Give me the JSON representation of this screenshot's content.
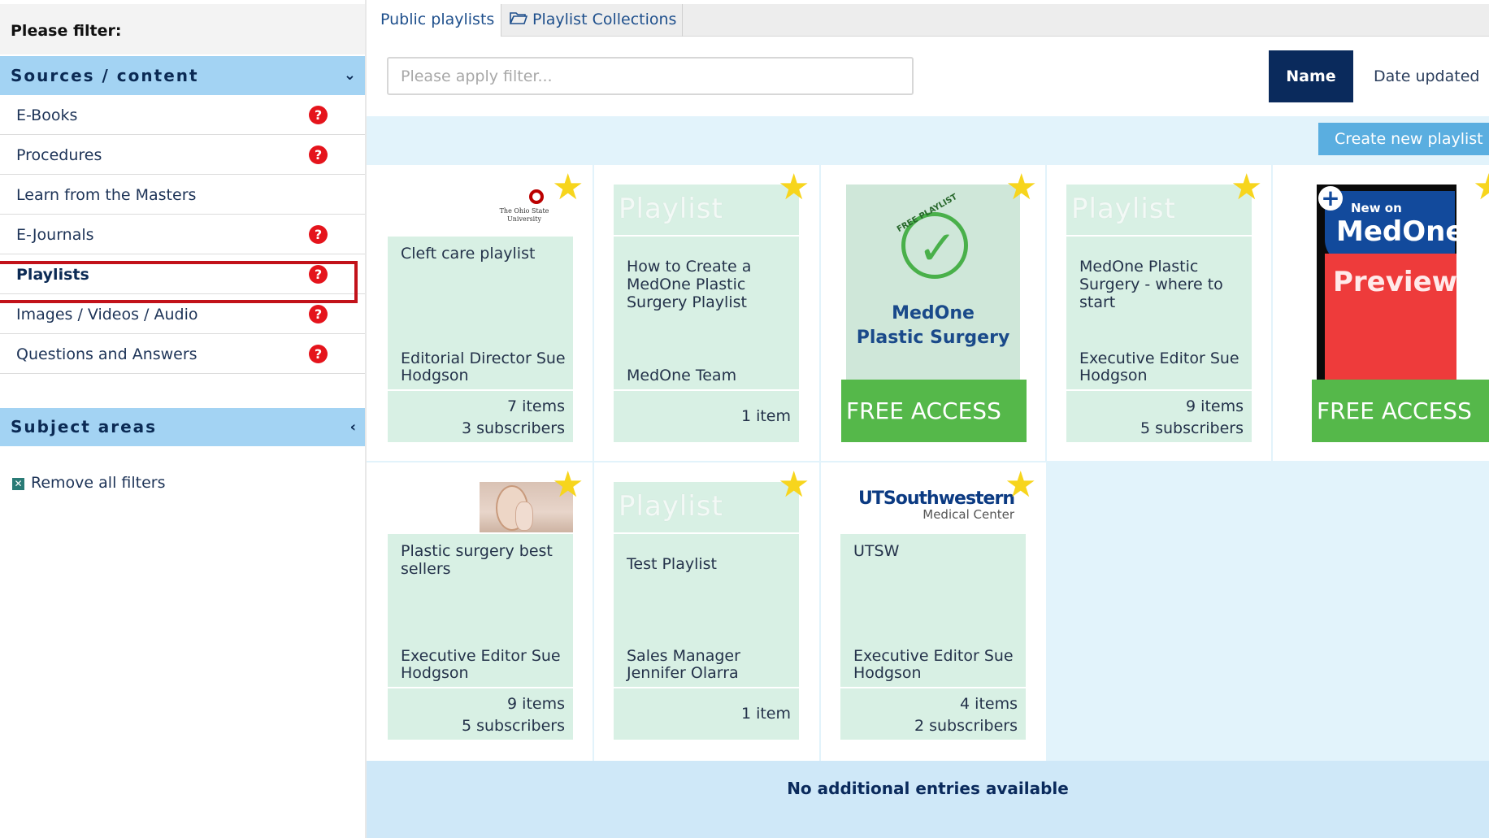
{
  "sidebar": {
    "heading": "Please filter:",
    "sources_header": "Sources / content",
    "sources_chevron": "⌄",
    "items": [
      {
        "label": "E-Books",
        "help": true
      },
      {
        "label": "Procedures",
        "help": true
      },
      {
        "label": "Learn from the Masters",
        "help": false
      },
      {
        "label": "E-Journals",
        "help": true
      },
      {
        "label": "Playlists",
        "help": true,
        "active": true
      },
      {
        "label": "Images / Videos / Audio",
        "help": true
      },
      {
        "label": "Questions and Answers",
        "help": true
      }
    ],
    "help_glyph": "?",
    "subject_header": "Subject areas",
    "subject_chevron": "‹",
    "remove_icon": "☒",
    "remove_label": "Remove all filters"
  },
  "tabs": {
    "public": "Public playlists",
    "collections": "Playlist Collections",
    "collections_icon": "folder-open-icon"
  },
  "toolbar": {
    "filter_placeholder": "Please apply filter...",
    "sort_name": "Name",
    "sort_date": "Date updated"
  },
  "create_button": "Create new playlist",
  "placeholder_word": "Playlist",
  "free_access": "FREE ACCESS",
  "cards": [
    {
      "title": "Cleft care playlist",
      "owner": "Editorial Director Sue Hodgson",
      "items": "7 items",
      "subscribers": "3 subscribers",
      "image": "ohio-state-logo"
    },
    {
      "title": "How to Create a MedOne Plastic Surgery Playlist",
      "owner": "MedOne Team",
      "items": "1 item",
      "subscribers": "",
      "image": "playlist-placeholder"
    },
    {
      "title": "",
      "owner": "",
      "items": "",
      "subscribers": "",
      "image": "medone-plastic-surgery-free"
    },
    {
      "title": "MedOne Plastic Surgery - where to start",
      "owner": "Executive Editor Sue Hodgson",
      "items": "9 items",
      "subscribers": "5 subscribers",
      "image": "playlist-placeholder"
    },
    {
      "title": "",
      "owner": "",
      "items": "",
      "subscribers": "",
      "image": "medone-preview-free"
    },
    {
      "title": "Plastic surgery best sellers",
      "owner": "Executive Editor Sue Hodgson",
      "items": "9 items",
      "subscribers": "5 subscribers",
      "image": "face-photo"
    },
    {
      "title": "Test Playlist",
      "owner": "Sales Manager Jennifer Olarra",
      "items": "1 item",
      "subscribers": "",
      "image": "playlist-placeholder"
    },
    {
      "title": "UTSW",
      "owner": "Executive Editor Sue Hodgson",
      "items": "4 items",
      "subscribers": "2 subscribers",
      "image": "ut-southwestern-logo"
    }
  ],
  "logos": {
    "osu_line1": "The Ohio State",
    "osu_line2": "University",
    "ut_main": "UTSouthwestern",
    "ut_sub": "Medical Center",
    "free_playlist_badge": "FREE PLAYLIST",
    "surgery_line1": "MedOne",
    "surgery_line2": "Plastic Surgery",
    "preview_new_on": "New on",
    "preview_medone": "MedOne",
    "preview_word": "Preview",
    "preview_plus": "+"
  },
  "star_glyph": "★",
  "bottom_message": "No additional entries available",
  "colors": {
    "accordion": "#a3d3f3",
    "sort_active": "#0a2a5c",
    "card_bg": "#d8f0e4",
    "free_access": "#55b84a",
    "star": "#f7d51d",
    "help": "#e5141c",
    "highlight": "#c2121a"
  }
}
